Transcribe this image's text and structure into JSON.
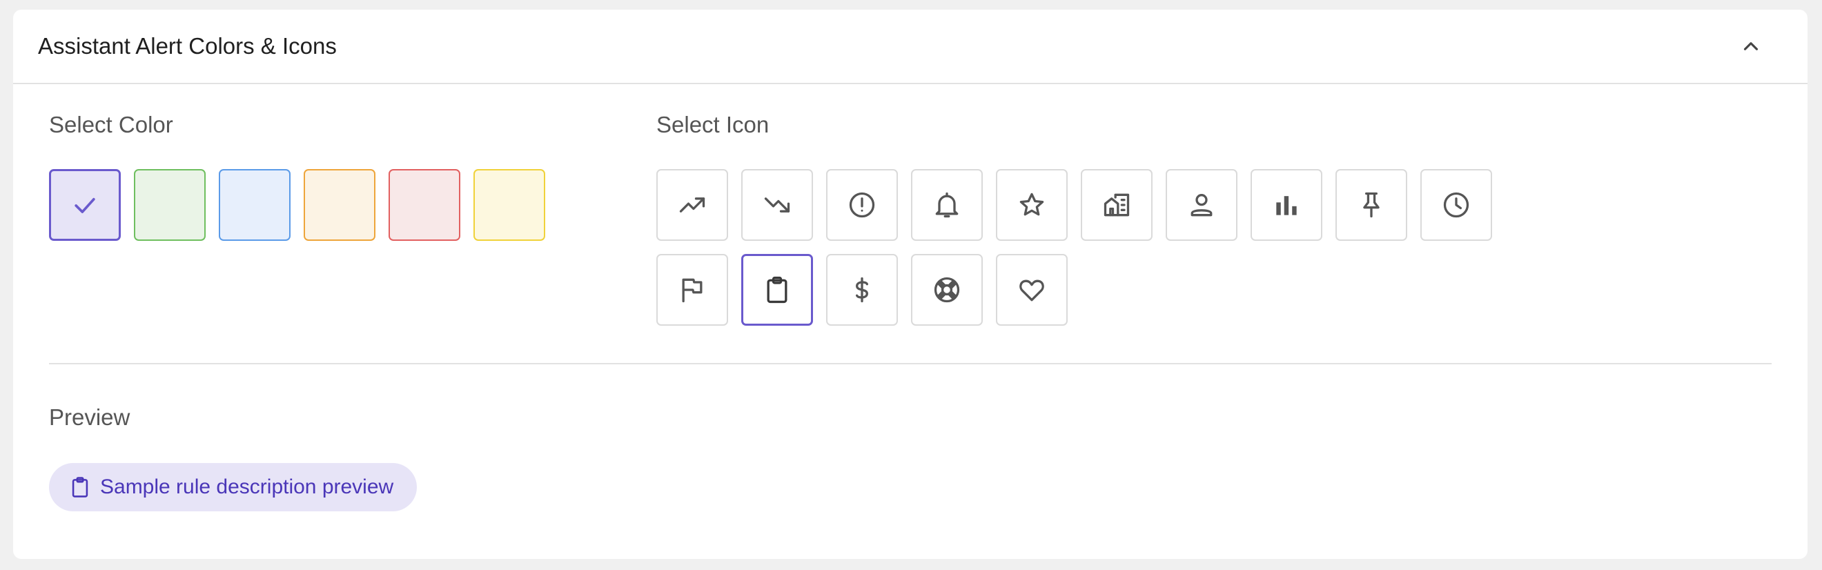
{
  "header": {
    "title": "Assistant Alert Colors & Icons",
    "collapse_icon": "chevron-up-icon"
  },
  "color_section": {
    "label": "Select Color",
    "selected_index": 0,
    "swatches": [
      {
        "name": "purple",
        "fill": "#e7e4f7",
        "border": "#6a5acd"
      },
      {
        "name": "green",
        "fill": "#eaf4e7",
        "border": "#6fbf5f"
      },
      {
        "name": "blue",
        "fill": "#e7effc",
        "border": "#5b9be8"
      },
      {
        "name": "orange",
        "fill": "#fcf3e4",
        "border": "#eea53a"
      },
      {
        "name": "red",
        "fill": "#f8e8e8",
        "border": "#e26060"
      },
      {
        "name": "yellow",
        "fill": "#fdf8df",
        "border": "#f0d23a"
      }
    ]
  },
  "icon_section": {
    "label": "Select Icon",
    "selected_index": 11,
    "icons": [
      "trending-up-icon",
      "trending-down-icon",
      "alert-circle-icon",
      "bell-icon",
      "star-icon",
      "buildings-icon",
      "person-icon",
      "bar-chart-icon",
      "pin-icon",
      "clock-icon",
      "flag-icon",
      "clipboard-icon",
      "dollar-icon",
      "lifebuoy-icon",
      "heart-icon"
    ]
  },
  "preview": {
    "label": "Preview",
    "chip_text": "Sample rule description preview",
    "chip_icon": "clipboard-icon",
    "chip_bg": "#e7e4f7",
    "chip_color": "#4a36b8"
  }
}
